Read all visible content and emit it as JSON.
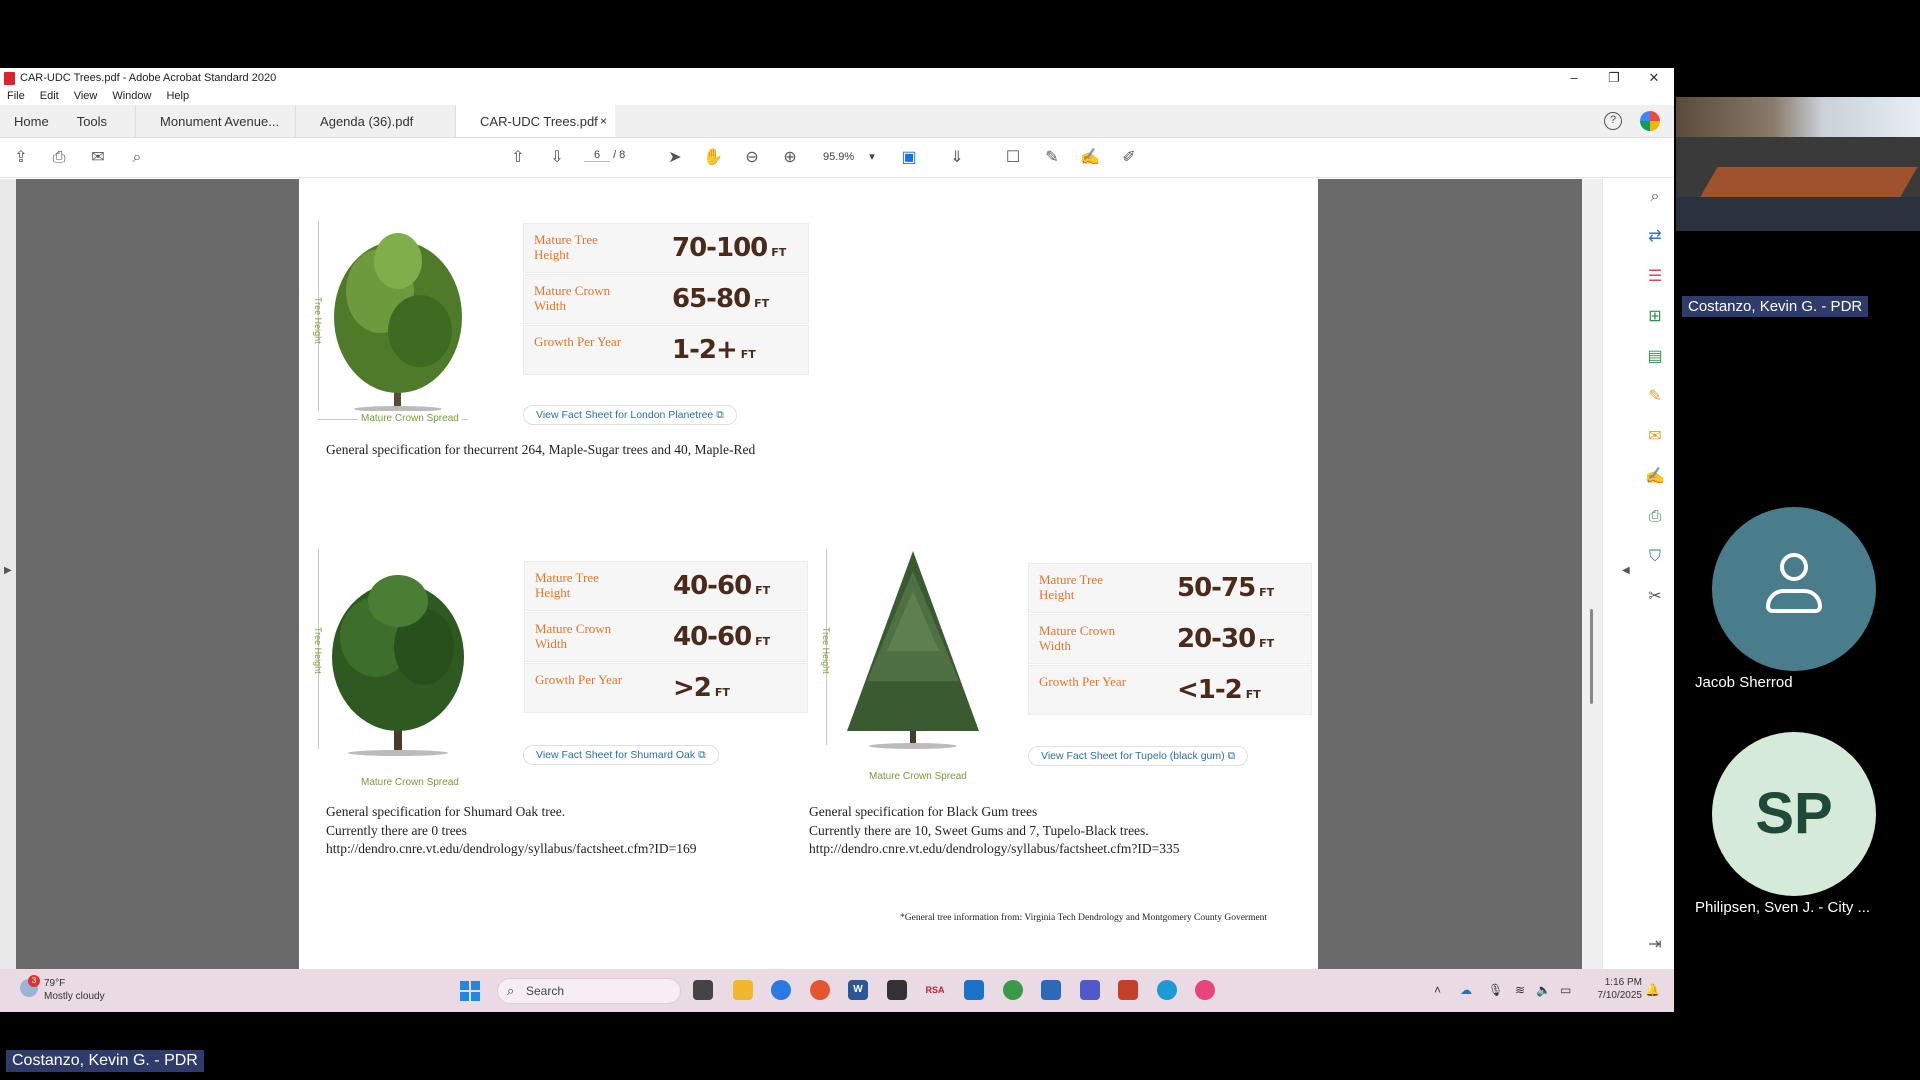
{
  "window": {
    "title": "CAR-UDC Trees.pdf - Adobe Acrobat Standard 2020",
    "controls": [
      "–",
      "❐",
      "✕"
    ]
  },
  "menu": [
    "File",
    "Edit",
    "View",
    "Window",
    "Help"
  ],
  "tabs": {
    "home": "Home",
    "tools": "Tools",
    "docs": [
      "Monument Avenue...",
      "Agenda (36).pdf",
      "CAR-UDC Trees.pdf"
    ],
    "close": "×",
    "help": "?"
  },
  "toolbar": {
    "page_current": "6",
    "page_total": "/ 8",
    "zoom": "95.9%",
    "zoom_caret": "▾"
  },
  "document": {
    "tree_height_label": "Tree Height",
    "crown_spread_label": "Mature Crown Spread",
    "trees": [
      {
        "height_label": "Mature Tree Height",
        "height": "70-100",
        "unit": "FT",
        "width_label": "Mature Crown Width",
        "width": "65-80",
        "growth_label": "Growth Per Year",
        "growth": "1-2+",
        "fact_sheet": "View Fact Sheet for London Planetree"
      },
      {
        "height_label": "Mature Tree Height",
        "height": "40-60",
        "unit": "FT",
        "width_label": "Mature Crown Width",
        "width": "40-60",
        "growth_label": "Growth Per Year",
        "growth": ">2",
        "fact_sheet": "View Fact Sheet for Shumard Oak"
      },
      {
        "height_label": "Mature Tree Height",
        "height": "50-75",
        "unit": "FT",
        "width_label": "Mature Crown Width",
        "width": "20-30",
        "growth_label": "Growth Per Year",
        "growth": "<1-2",
        "fact_sheet": "View Fact Sheet for Tupelo (black gum)"
      }
    ],
    "spec_maple": "General specification for thecurrent 264, Maple-Sugar trees and 40, Maple-Red",
    "spec_oak": [
      "General specification for Shumard Oak tree.",
      "Currently there are 0 trees",
      "http://dendro.cnre.vt.edu/dendrology/syllabus/factsheet.cfm?ID=169"
    ],
    "spec_gum": [
      "General specification for Black Gum trees",
      "Currently there are 10, Sweet Gums and 7, Tupelo-Black trees.",
      "http://dendro.cnre.vt.edu/dendrology/syllabus/factsheet.cfm?ID=335"
    ],
    "footnote": "*General tree information from: Virginia Tech Dendrology and Montgomery County Goverment"
  },
  "taskbar": {
    "weather_temp": "79°F",
    "weather_desc": "Mostly cloudy",
    "weather_badge": "3",
    "search": "Search",
    "time": "1:16 PM",
    "date": "7/10/2025",
    "app_labels": [
      "RSA",
      "W"
    ]
  },
  "meeting": {
    "speaker_tag": "Costanzo, Kevin G. - PDR",
    "participant_1": "Jacob Sherrod",
    "participant_2_initials": "SP",
    "participant_2": "Philipsen, Sven J. - City ...",
    "bottom_tag": "Costanzo, Kevin G. - PDR"
  },
  "colors": {
    "label_orange": "#e0752b",
    "value_brown": "#4a2a1a",
    "link_blue": "#2a6fa8",
    "accent_green": "#7a9a3a",
    "name_tag_bg": "#2f3b6b"
  }
}
